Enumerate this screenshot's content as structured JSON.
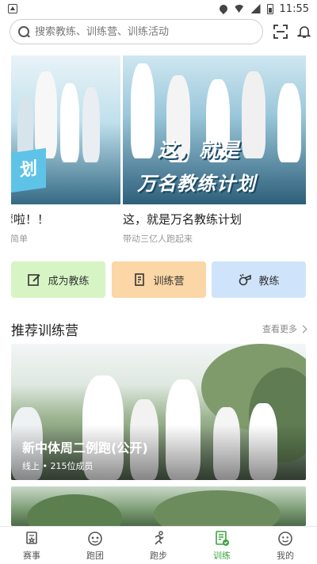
{
  "status_bar": {
    "time": "11:55"
  },
  "search": {
    "placeholder": "搜索教练、训练营、训练活动"
  },
  "banner": {
    "slides": [
      {
        "art_text": "划",
        "title": "摩啦！！",
        "subtitle": "比简单"
      },
      {
        "art_line1": "这，就是",
        "art_line2": "万名教练计划",
        "title": "这，就是万名教练计划",
        "subtitle": "带动三亿人跑起来"
      }
    ]
  },
  "actions": [
    {
      "label": "成为教练",
      "icon": "edit-icon",
      "color": "#d7f5c4"
    },
    {
      "label": "训练营",
      "icon": "document-icon",
      "color": "#fbd6a6"
    },
    {
      "label": "教练",
      "icon": "whistle-icon",
      "color": "#cfe4fb"
    }
  ],
  "recommended": {
    "title": "推荐训练营",
    "more_label": "查看更多",
    "camps": [
      {
        "title": "新中体周二例跑(公开)",
        "meta": "线上 • 215位成员"
      }
    ]
  },
  "bottom_nav": {
    "active_color": "#3aa53c",
    "items": [
      {
        "label": "赛事",
        "icon": "medal-icon"
      },
      {
        "label": "跑团",
        "icon": "group-icon"
      },
      {
        "label": "跑步",
        "icon": "runner-icon"
      },
      {
        "label": "训练",
        "icon": "training-icon",
        "active": true
      },
      {
        "label": "我的",
        "icon": "profile-icon"
      }
    ]
  }
}
